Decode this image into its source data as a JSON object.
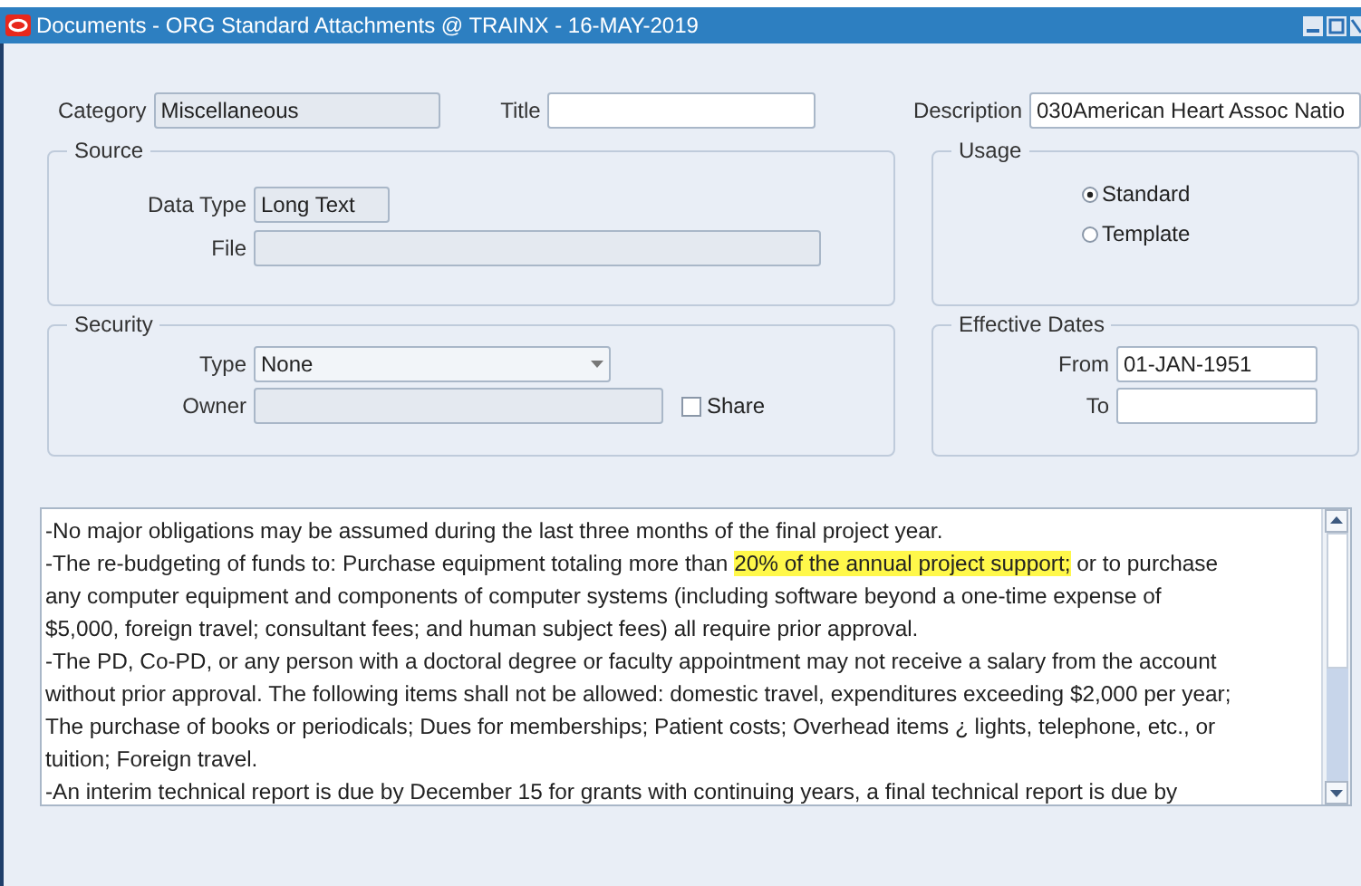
{
  "window": {
    "title": "Documents - ORG Standard Attachments @ TRAINX - 16-MAY-2019"
  },
  "header": {
    "category": {
      "label": "Category",
      "value": "Miscellaneous"
    },
    "title": {
      "label": "Title"
    },
    "description": {
      "label": "Description",
      "value": "030American Heart Assoc Natio"
    }
  },
  "source": {
    "legend": "Source",
    "data_type": {
      "label": "Data Type",
      "value": "Long Text"
    },
    "file": {
      "label": "File"
    }
  },
  "usage": {
    "legend": "Usage",
    "options": [
      {
        "label": "Standard",
        "selected": true
      },
      {
        "label": "Template",
        "selected": false
      }
    ]
  },
  "security": {
    "legend": "Security",
    "type": {
      "label": "Type",
      "value": "None"
    },
    "owner": {
      "label": "Owner"
    },
    "share": {
      "label": "Share",
      "checked": false
    }
  },
  "effective_dates": {
    "legend": "Effective Dates",
    "from": {
      "label": "From",
      "value": "01-JAN-1951"
    },
    "to": {
      "label": "To"
    }
  },
  "text_lines": [
    [
      {
        "text": "-No major obligations may be assumed during the last three months of the final project year.",
        "highlighted": false
      }
    ],
    [
      {
        "text": "-The re-budgeting of funds to: Purchase equipment totaling more than ",
        "highlighted": false
      },
      {
        "text": "20% of the annual project support;",
        "highlighted": true
      },
      {
        "text": " or to purchase",
        "highlighted": false
      }
    ],
    [
      {
        "text": "any computer equipment and components of computer systems (including software beyond a one-time expense of",
        "highlighted": false
      }
    ],
    [
      {
        "text": "$5,000, foreign travel; consultant fees; and human subject fees) all require prior approval.",
        "highlighted": false
      }
    ],
    [
      {
        "text": "-The PD, Co-PD, or any person with a doctoral degree or faculty appointment may not receive a salary from the account",
        "highlighted": false
      }
    ],
    [
      {
        "text": "without prior approval.  The following items shall not be allowed: domestic travel, expenditures exceeding $2,000 per year;",
        "highlighted": false
      }
    ],
    [
      {
        "text": "The purchase of books or periodicals; Dues for memberships; Patient costs; Overhead items ¿ lights, telephone, etc., or",
        "highlighted": false
      }
    ],
    [
      {
        "text": "tuition; Foreign travel.",
        "highlighted": false
      }
    ],
    [
      {
        "text": "-An interim technical report is due by December 15 for grants with continuing years, a final technical report is due by",
        "highlighted": false
      }
    ]
  ]
}
